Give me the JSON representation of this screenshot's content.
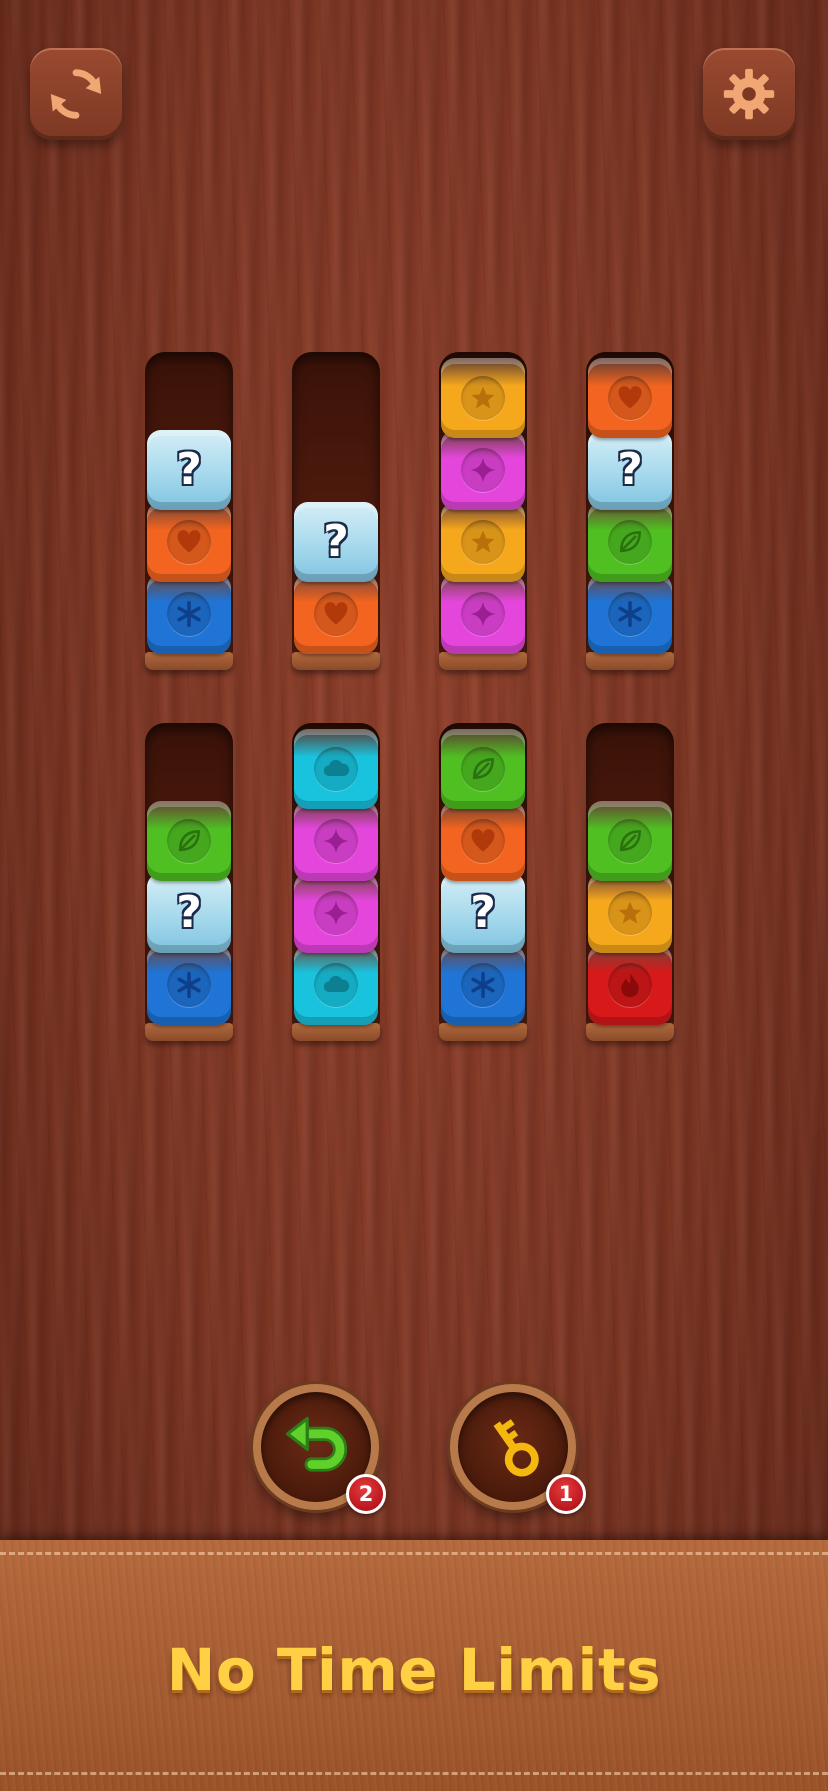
{
  "controls": {
    "restart_icon": "refresh-icon",
    "settings_icon": "gear-icon",
    "undo_icon": "undo-arrow-icon",
    "undo_count": "2",
    "hint_icon": "key-icon",
    "hint_count": "1"
  },
  "colors": {
    "blue": "#1f74d6",
    "orange": "#f2641f",
    "yellow": "#f6a81d",
    "pink": "#e446dc",
    "green": "#4fbf22",
    "cyan": "#19c3de",
    "red": "#d7191a",
    "mystery": "#a6d9ec"
  },
  "board": {
    "columns": [
      {
        "blocks": [
          "blue-snowflake",
          "orange-heart",
          "mystery"
        ]
      },
      {
        "blocks": [
          "orange-heart",
          "mystery"
        ]
      },
      {
        "blocks": [
          "pink-sparkle",
          "yellow-star",
          "pink-sparkle",
          "yellow-star"
        ]
      },
      {
        "blocks": [
          "blue-snowflake",
          "green-leaf",
          "mystery",
          "orange-heart"
        ]
      },
      {
        "blocks": [
          "blue-snowflake",
          "mystery",
          "green-leaf"
        ]
      },
      {
        "blocks": [
          "cyan-cloud",
          "pink-sparkle",
          "pink-sparkle",
          "cyan-cloud"
        ]
      },
      {
        "blocks": [
          "blue-snowflake",
          "mystery",
          "orange-heart",
          "green-leaf"
        ]
      },
      {
        "blocks": [
          "red-flame",
          "yellow-star",
          "green-leaf"
        ]
      }
    ],
    "mystery_symbol": "?"
  },
  "banner": {
    "text": "No Time Limits"
  }
}
